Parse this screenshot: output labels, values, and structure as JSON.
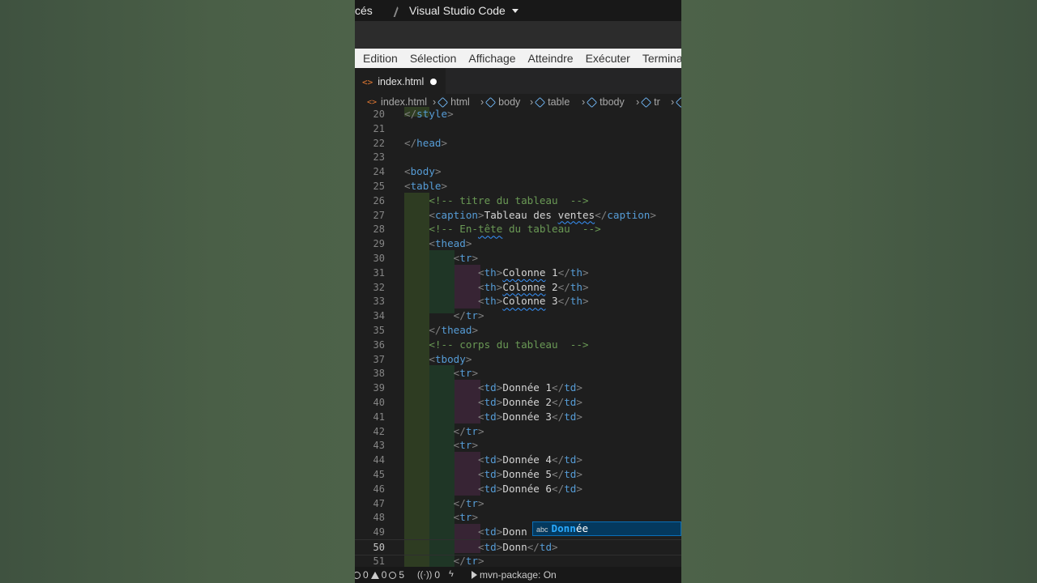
{
  "os_topbar": {
    "left_text": "cés",
    "app_name": "Visual Studio Code"
  },
  "menu": [
    "Edition",
    "Sélection",
    "Affichage",
    "Atteindre",
    "Exécuter",
    "Termina"
  ],
  "tab": {
    "icon": "<>",
    "filename": "index.html"
  },
  "breadcrumbs": [
    "index.html",
    "html",
    "body",
    "table",
    "tbody",
    "tr"
  ],
  "editor": {
    "lines": [
      {
        "num": "20",
        "tokens": [
          [
            "t",
            "</"
          ],
          [
            "n",
            "style"
          ],
          [
            "t",
            ">"
          ]
        ]
      },
      {
        "num": "21",
        "tokens": []
      },
      {
        "num": "22",
        "tokens": [
          [
            "t",
            "</"
          ],
          [
            "n",
            "head"
          ],
          [
            "t",
            ">"
          ]
        ]
      },
      {
        "num": "23",
        "tokens": []
      },
      {
        "num": "24",
        "tokens": [
          [
            "t",
            "<"
          ],
          [
            "n",
            "body"
          ],
          [
            "t",
            ">"
          ]
        ]
      },
      {
        "num": "25",
        "tokens": [
          [
            "t",
            "<"
          ],
          [
            "n",
            "table"
          ],
          [
            "t",
            ">"
          ]
        ]
      },
      {
        "num": "26",
        "tokens": [
          [
            "w",
            "    "
          ],
          [
            "c",
            "<!-- titre du tableau  -->"
          ]
        ]
      },
      {
        "num": "27",
        "tokens": [
          [
            "w",
            "    "
          ],
          [
            "t",
            "<"
          ],
          [
            "n",
            "caption"
          ],
          [
            "t",
            ">"
          ],
          [
            "w",
            "Tableau des "
          ],
          [
            "sq",
            "ventes"
          ],
          [
            "t",
            "</"
          ],
          [
            "n",
            "caption"
          ],
          [
            "t",
            ">"
          ]
        ]
      },
      {
        "num": "28",
        "tokens": [
          [
            "w",
            "    "
          ],
          [
            "c",
            "<!-- En-"
          ],
          [
            "csq",
            "tête"
          ],
          [
            "c",
            " du tableau  -->"
          ]
        ]
      },
      {
        "num": "29",
        "tokens": [
          [
            "w",
            "    "
          ],
          [
            "t",
            "<"
          ],
          [
            "n",
            "thead"
          ],
          [
            "t",
            ">"
          ]
        ]
      },
      {
        "num": "30",
        "tokens": [
          [
            "w",
            "        "
          ],
          [
            "t",
            "<"
          ],
          [
            "n",
            "tr"
          ],
          [
            "t",
            ">"
          ]
        ]
      },
      {
        "num": "31",
        "tokens": [
          [
            "w",
            "            "
          ],
          [
            "t",
            "<"
          ],
          [
            "n",
            "th"
          ],
          [
            "t",
            ">"
          ],
          [
            "sq",
            "Colonne"
          ],
          [
            "w",
            " 1"
          ],
          [
            "t",
            "</"
          ],
          [
            "n",
            "th"
          ],
          [
            "t",
            ">"
          ]
        ]
      },
      {
        "num": "32",
        "tokens": [
          [
            "w",
            "            "
          ],
          [
            "t",
            "<"
          ],
          [
            "n",
            "th"
          ],
          [
            "t",
            ">"
          ],
          [
            "sq",
            "Colonne"
          ],
          [
            "w",
            " 2"
          ],
          [
            "t",
            "</"
          ],
          [
            "n",
            "th"
          ],
          [
            "t",
            ">"
          ]
        ]
      },
      {
        "num": "33",
        "tokens": [
          [
            "w",
            "            "
          ],
          [
            "t",
            "<"
          ],
          [
            "n",
            "th"
          ],
          [
            "t",
            ">"
          ],
          [
            "sq",
            "Colonne"
          ],
          [
            "w",
            " 3"
          ],
          [
            "t",
            "</"
          ],
          [
            "n",
            "th"
          ],
          [
            "t",
            ">"
          ]
        ]
      },
      {
        "num": "34",
        "tokens": [
          [
            "w",
            "        "
          ],
          [
            "t",
            "</"
          ],
          [
            "n",
            "tr"
          ],
          [
            "t",
            ">"
          ]
        ]
      },
      {
        "num": "35",
        "tokens": [
          [
            "w",
            "    "
          ],
          [
            "t",
            "</"
          ],
          [
            "n",
            "thead"
          ],
          [
            "t",
            ">"
          ]
        ]
      },
      {
        "num": "36",
        "tokens": [
          [
            "w",
            "    "
          ],
          [
            "c",
            "<!-- corps du tableau  -->"
          ]
        ]
      },
      {
        "num": "37",
        "tokens": [
          [
            "w",
            "    "
          ],
          [
            "t",
            "<"
          ],
          [
            "n",
            "tbody"
          ],
          [
            "t",
            ">"
          ]
        ]
      },
      {
        "num": "38",
        "tokens": [
          [
            "w",
            "        "
          ],
          [
            "t",
            "<"
          ],
          [
            "n",
            "tr"
          ],
          [
            "t",
            ">"
          ]
        ]
      },
      {
        "num": "39",
        "tokens": [
          [
            "w",
            "            "
          ],
          [
            "t",
            "<"
          ],
          [
            "n",
            "td"
          ],
          [
            "t",
            ">"
          ],
          [
            "w",
            "Donnée 1"
          ],
          [
            "t",
            "</"
          ],
          [
            "n",
            "td"
          ],
          [
            "t",
            ">"
          ]
        ]
      },
      {
        "num": "40",
        "tokens": [
          [
            "w",
            "            "
          ],
          [
            "t",
            "<"
          ],
          [
            "n",
            "td"
          ],
          [
            "t",
            ">"
          ],
          [
            "w",
            "Donnée 2"
          ],
          [
            "t",
            "</"
          ],
          [
            "n",
            "td"
          ],
          [
            "t",
            ">"
          ]
        ]
      },
      {
        "num": "41",
        "tokens": [
          [
            "w",
            "            "
          ],
          [
            "t",
            "<"
          ],
          [
            "n",
            "td"
          ],
          [
            "t",
            ">"
          ],
          [
            "w",
            "Donnée 3"
          ],
          [
            "t",
            "</"
          ],
          [
            "n",
            "td"
          ],
          [
            "t",
            ">"
          ]
        ]
      },
      {
        "num": "42",
        "tokens": [
          [
            "w",
            "        "
          ],
          [
            "t",
            "</"
          ],
          [
            "n",
            "tr"
          ],
          [
            "t",
            ">"
          ]
        ]
      },
      {
        "num": "43",
        "tokens": [
          [
            "w",
            "        "
          ],
          [
            "t",
            "<"
          ],
          [
            "n",
            "tr"
          ],
          [
            "t",
            ">"
          ]
        ]
      },
      {
        "num": "44",
        "tokens": [
          [
            "w",
            "            "
          ],
          [
            "t",
            "<"
          ],
          [
            "n",
            "td"
          ],
          [
            "t",
            ">"
          ],
          [
            "w",
            "Donnée 4"
          ],
          [
            "t",
            "</"
          ],
          [
            "n",
            "td"
          ],
          [
            "t",
            ">"
          ]
        ]
      },
      {
        "num": "45",
        "tokens": [
          [
            "w",
            "            "
          ],
          [
            "t",
            "<"
          ],
          [
            "n",
            "td"
          ],
          [
            "t",
            ">"
          ],
          [
            "w",
            "Donnée 5"
          ],
          [
            "t",
            "</"
          ],
          [
            "n",
            "td"
          ],
          [
            "t",
            ">"
          ]
        ]
      },
      {
        "num": "46",
        "tokens": [
          [
            "w",
            "            "
          ],
          [
            "t",
            "<"
          ],
          [
            "n",
            "td"
          ],
          [
            "t",
            ">"
          ],
          [
            "w",
            "Donnée 6"
          ],
          [
            "t",
            "</"
          ],
          [
            "n",
            "td"
          ],
          [
            "t",
            ">"
          ]
        ]
      },
      {
        "num": "47",
        "tokens": [
          [
            "w",
            "        "
          ],
          [
            "t",
            "</"
          ],
          [
            "n",
            "tr"
          ],
          [
            "t",
            ">"
          ]
        ]
      },
      {
        "num": "48",
        "tokens": [
          [
            "w",
            "        "
          ],
          [
            "t",
            "<"
          ],
          [
            "n",
            "tr"
          ],
          [
            "t",
            ">"
          ]
        ]
      },
      {
        "num": "49",
        "tokens": [
          [
            "w",
            "            "
          ],
          [
            "t",
            "<"
          ],
          [
            "n",
            "td"
          ],
          [
            "t",
            ">"
          ],
          [
            "w",
            "Donn"
          ]
        ]
      },
      {
        "num": "50",
        "tokens": [
          [
            "w",
            "            "
          ],
          [
            "t",
            "<"
          ],
          [
            "n",
            "td"
          ],
          [
            "t",
            ">"
          ],
          [
            "w",
            "Donn"
          ],
          [
            "t",
            "</"
          ],
          [
            "n",
            "td"
          ],
          [
            "t",
            ">"
          ]
        ]
      },
      {
        "num": "51",
        "tokens": [
          [
            "w",
            "        "
          ],
          [
            "t",
            "</"
          ],
          [
            "n",
            "tr"
          ],
          [
            "t",
            ">"
          ]
        ]
      }
    ],
    "active_line": "50"
  },
  "suggestion": {
    "kind": "abc",
    "match": "Donn",
    "rest": "ée"
  },
  "statusbar": {
    "errors": "0",
    "warnings": "0",
    "info": "5",
    "ports": "0",
    "maven": "mvn-package: On"
  },
  "colors": {
    "accent": "#3794ff",
    "tag": "#569cd6",
    "comment": "#6a9955"
  }
}
